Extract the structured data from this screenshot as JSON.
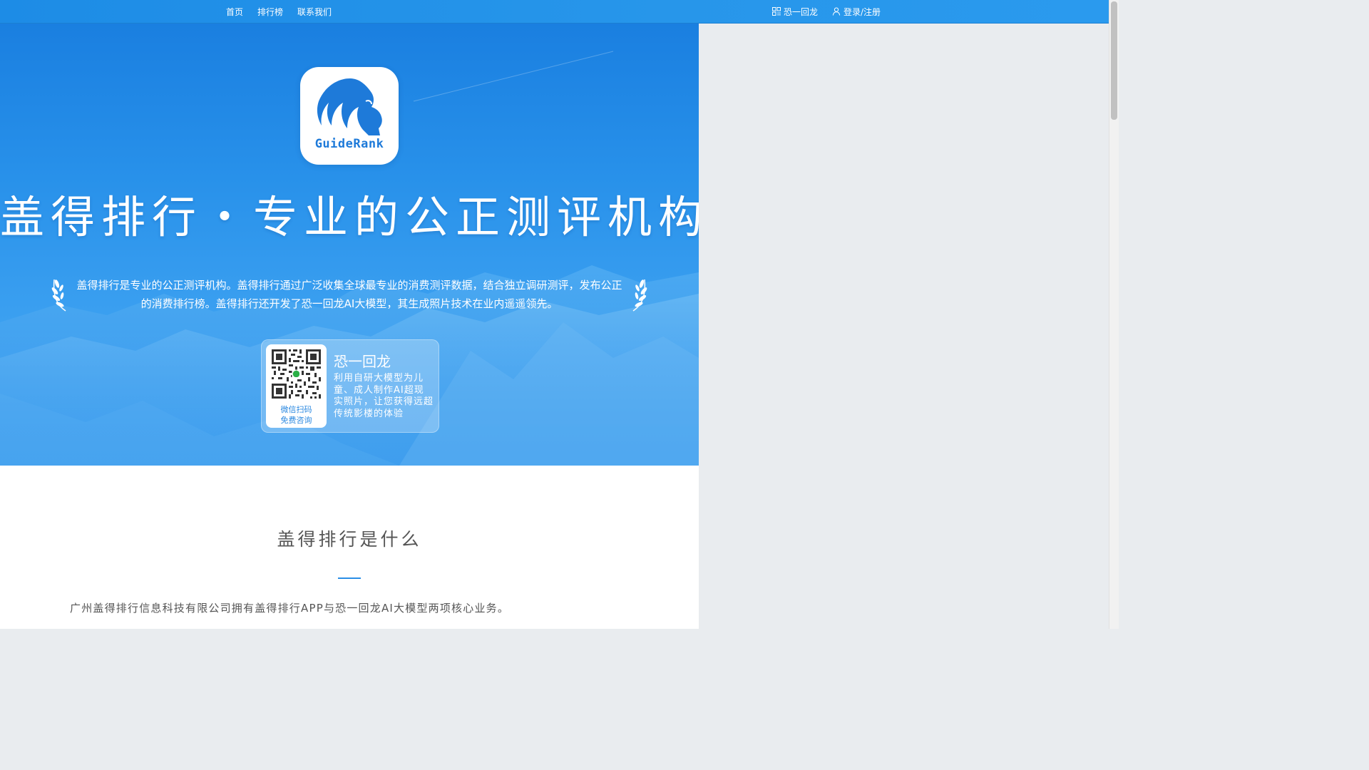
{
  "nav": {
    "left": [
      {
        "label": "首页"
      },
      {
        "label": "排行榜"
      },
      {
        "label": "联系我们"
      }
    ],
    "right": [
      {
        "label": "恐一回龙",
        "icon": "qrcode-icon"
      },
      {
        "label": "登录/注册",
        "icon": "user-icon"
      }
    ]
  },
  "hero": {
    "logo_text": "GuideRank",
    "title": "盖得排行・专业的公正测评机构",
    "description": "盖得排行是专业的公正测评机构。盖得排行通过广泛收集全球最专业的消费测评数据，结合独立调研测评，发布公正的消费排行榜。盖得排行还开发了恐一回龙AI大模型，其生成照片技术在业内遥遥领先。",
    "card": {
      "qr_caption_1": "微信扫码",
      "qr_caption_2": "免费咨询",
      "title": "恐一回龙",
      "description": "利用自研大模型为儿童、成人制作AI超现实照片，让您获得远超传统影楼的体验"
    }
  },
  "section": {
    "title": "盖得排行是什么",
    "text": "广州盖得排行信息科技有限公司拥有盖得排行APP与恐一回龙AI大模型两项核心业务。"
  },
  "colors": {
    "brand_blue": "#1e7ad9",
    "nav_bg": "#2796ea",
    "accent_line": "#2a8ee6"
  }
}
